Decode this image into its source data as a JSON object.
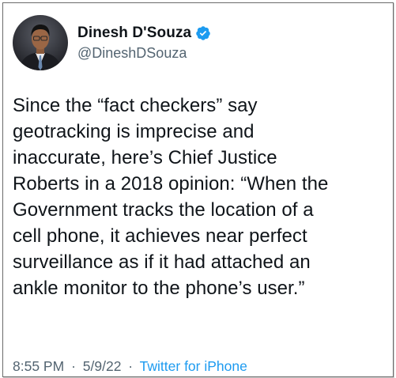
{
  "tweet": {
    "author": {
      "display_name": "Dinesh D'Souza",
      "handle": "@DineshDSouza",
      "verified": true,
      "avatar_icon": "profile-photo"
    },
    "text": "Since the “fact checkers” say\ngeotracking is imprecise and\ninaccurate, here’s Chief Justice\nRoberts in a 2018 opinion: “When the\nGovernment tracks the location of a\ncell phone, it achieves near perfect\nsurveillance as if it had attached an\nankle monitor to the phone’s user.”",
    "meta": {
      "time": "8:55 PM",
      "separator": "·",
      "date": "5/9/22",
      "source": "Twitter for iPhone"
    }
  },
  "colors": {
    "text": "#0f1419",
    "secondary": "#536471",
    "link": "#1d9bf0",
    "verified": "#1d9bf0"
  }
}
